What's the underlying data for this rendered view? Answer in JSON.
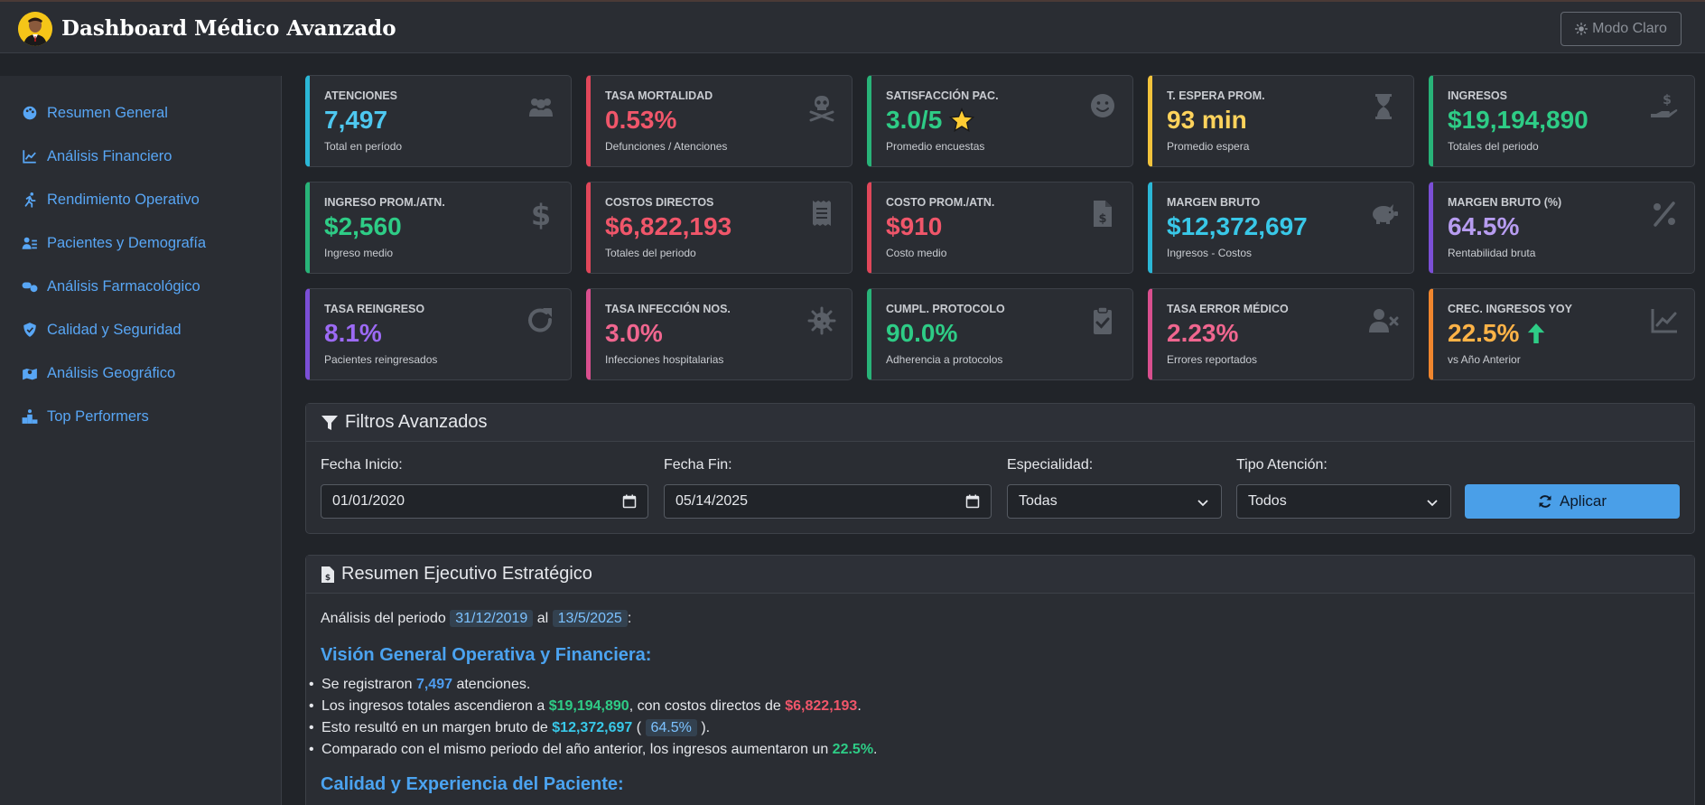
{
  "header": {
    "title": "Dashboard Médico Avanzado",
    "mode_button": "Modo Claro"
  },
  "sidebar": {
    "items": [
      {
        "label": "Resumen General",
        "icon": "palette-icon"
      },
      {
        "label": "Análisis Financiero",
        "icon": "chart-line-icon"
      },
      {
        "label": "Rendimiento Operativo",
        "icon": "running-icon"
      },
      {
        "label": "Pacientes y Demografía",
        "icon": "user-group-icon"
      },
      {
        "label": "Análisis Farmacológico",
        "icon": "pills-icon"
      },
      {
        "label": "Calidad y Seguridad",
        "icon": "shield-icon"
      },
      {
        "label": "Análisis Geográfico",
        "icon": "map-icon"
      },
      {
        "label": "Top Performers",
        "icon": "podium-icon"
      }
    ]
  },
  "cards": [
    {
      "title": "ATENCIONES",
      "value": "7,497",
      "sub": "Total en período",
      "color": "#2bb7d6",
      "accent": "#4ec8f0",
      "icon": "users-icon"
    },
    {
      "title": "TASA MORTALIDAD",
      "value": "0.53%",
      "sub": "Defunciones / Atenciones",
      "color": "#e0475a",
      "accent": "#f0566a",
      "icon": "skull-icon"
    },
    {
      "title": "SATISFACCIÓN PAC.",
      "value": "3.0/5",
      "sub": "Promedio encuestas",
      "color": "#28b378",
      "accent": "#2ecc86",
      "icon": "smile-icon"
    },
    {
      "title": "T. ESPERA PROM.",
      "value": "93 min",
      "sub": "Promedio espera",
      "color": "#f2c33c",
      "accent": "#ffd35c",
      "icon": "hourglass-icon"
    },
    {
      "title": "INGRESOS",
      "value": "$19,194,890",
      "sub": "Totales del periodo",
      "color": "#28b378",
      "accent": "#2ecc86",
      "icon": "hand-dollar-icon"
    },
    {
      "title": "INGRESO PROM./ATN.",
      "value": "$2,560",
      "sub": "Ingreso medio",
      "color": "#28b378",
      "accent": "#2ecc86",
      "icon": "dollar-icon"
    },
    {
      "title": "COSTOS DIRECTOS",
      "value": "$6,822,193",
      "sub": "Totales del periodo",
      "color": "#e0475a",
      "accent": "#f0566a",
      "icon": "receipt-icon"
    },
    {
      "title": "COSTO PROM./ATN.",
      "value": "$910",
      "sub": "Costo medio",
      "color": "#e0475a",
      "accent": "#f0566a",
      "icon": "invoice-icon"
    },
    {
      "title": "MARGEN BRUTO",
      "value": "$12,372,697",
      "sub": "Ingresos - Costos",
      "color": "#2bb7d6",
      "accent": "#39c8e8",
      "icon": "piggy-bank-icon"
    },
    {
      "title": "MARGEN BRUTO (%)",
      "value": "64.5%",
      "sub": "Rentabilidad bruta",
      "color": "#7b4fd6",
      "accent": "#b79cf0",
      "icon": "percent-icon"
    },
    {
      "title": "TASA REINGRESO",
      "value": "8.1%",
      "sub": "Pacientes reingresados",
      "color": "#7b4fd6",
      "accent": "#9c6af5",
      "icon": "redo-icon"
    },
    {
      "title": "TASA INFECCIÓN NOS.",
      "value": "3.0%",
      "sub": "Infecciones hospitalarias",
      "color": "#d94f8e",
      "accent": "#f0668f",
      "icon": "virus-icon"
    },
    {
      "title": "CUMPL. PROTOCOLO",
      "value": "90.0%",
      "sub": "Adherencia a protocolos",
      "color": "#28b378",
      "accent": "#2ecc86",
      "icon": "clipboard-check-icon"
    },
    {
      "title": "TASA ERROR MÉDICO",
      "value": "2.23%",
      "sub": "Errores reportados",
      "color": "#d94f8e",
      "accent": "#f0668f",
      "icon": "user-x-icon"
    },
    {
      "title": "CREC. INGRESOS YOY",
      "value": "22.5%",
      "sub": "vs Año Anterior",
      "color": "#f0862e",
      "accent": "#ffb347",
      "icon": "trend-icon"
    }
  ],
  "filters": {
    "title": "Filtros Avanzados",
    "fecha_inicio_label": "Fecha Inicio:",
    "fecha_inicio_value": "01/01/2020",
    "fecha_fin_label": "Fecha Fin:",
    "fecha_fin_value": "05/14/2025",
    "especialidad_label": "Especialidad:",
    "especialidad_value": "Todas",
    "tipo_label": "Tipo Atención:",
    "tipo_value": "Todos",
    "apply_label": "Aplicar"
  },
  "summary": {
    "title": "Resumen Ejecutivo Estratégico",
    "period_prefix": "Análisis del periodo",
    "period_start": "31/12/2019",
    "period_mid": "al",
    "period_end": "13/5/2025",
    "period_suffix": ":",
    "section1_title": "Visión General Operativa y Financiera:",
    "b1_a": "Se registraron",
    "b1_v": "7,497",
    "b1_b": "atenciones.",
    "b2_a": "Los ingresos totales ascendieron a",
    "b2_v1": "$19,194,890",
    "b2_b": ", con costos directos de",
    "b2_v2": "$6,822,193",
    "b2_c": ".",
    "b3_a": "Esto resultó en un margen bruto de",
    "b3_v1": "$12,372,697",
    "b3_b": "(",
    "b3_v2": "64.5%",
    "b3_c": ").",
    "b4_a": "Comparado con el mismo periodo del año anterior, los ingresos aumentaron un",
    "b4_v": "22.5%",
    "b4_b": ".",
    "section2_title": "Calidad y Experiencia del Paciente:"
  }
}
